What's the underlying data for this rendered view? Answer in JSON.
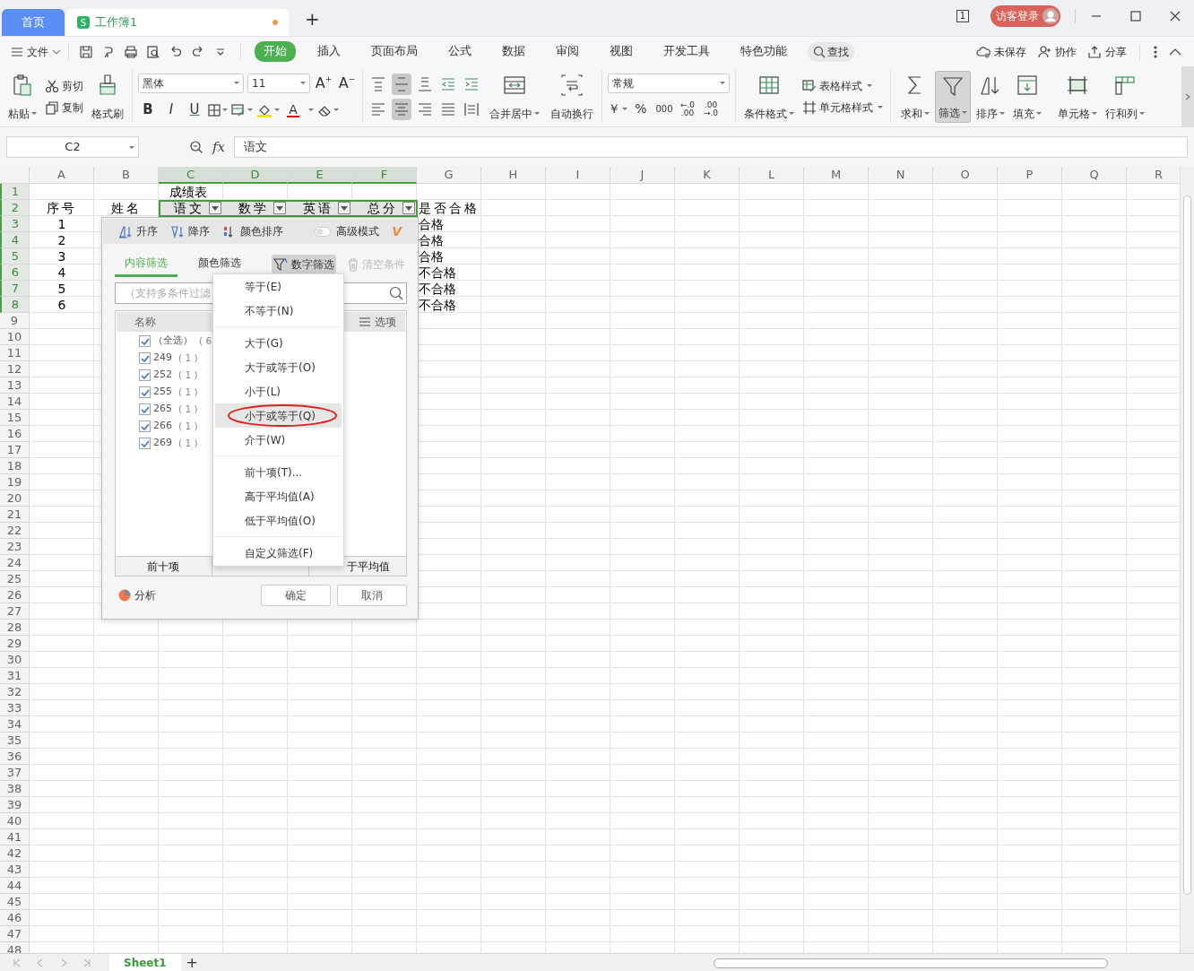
{
  "window_tabs": [
    {
      "label": "首页",
      "kind": "home",
      "selected": false
    },
    {
      "label": "工作簿1",
      "kind": "workbook",
      "badge": "S",
      "unsaved": true,
      "selected": true
    }
  ],
  "new_tab": "+",
  "title_bar": {
    "page_count": "1",
    "login": "访客登录"
  },
  "menu_bar": {
    "file": "文件",
    "tabs": [
      {
        "label": "开始",
        "selected": true
      },
      {
        "label": "插入",
        "selected": false
      },
      {
        "label": "页面布局",
        "selected": false
      },
      {
        "label": "公式",
        "selected": false
      },
      {
        "label": "数据",
        "selected": false
      },
      {
        "label": "审阅",
        "selected": false
      },
      {
        "label": "视图",
        "selected": false
      },
      {
        "label": "开发工具",
        "selected": false
      },
      {
        "label": "特色功能",
        "selected": false
      }
    ],
    "search": "查找",
    "actions": [
      {
        "label": "未保存",
        "kind": "cloud"
      },
      {
        "label": "协作",
        "kind": "collab"
      },
      {
        "label": "分享",
        "kind": "share"
      }
    ]
  },
  "ribbon": {
    "paste": "粘贴",
    "cut": "剪切",
    "copy": "复制",
    "format_painter": "格式刷",
    "font": "黑体",
    "font_size": "11",
    "size_buttons": [
      {
        "label": "A",
        "sign": "+"
      },
      {
        "label": "A",
        "sign": "−"
      }
    ],
    "style_buttons": [
      {
        "kind": "bold",
        "label": "B"
      },
      {
        "kind": "italic",
        "label": "I"
      },
      {
        "kind": "underline",
        "label": "U"
      }
    ],
    "font_color_label": "A",
    "alignment": [
      {
        "kind": "top",
        "selected": false
      },
      {
        "kind": "middle",
        "selected": true
      },
      {
        "kind": "bottom",
        "selected": false
      },
      {
        "kind": "outdent",
        "selected": false
      },
      {
        "kind": "indent",
        "selected": false
      },
      {
        "kind": "left",
        "selected": false
      },
      {
        "kind": "center",
        "selected": true
      },
      {
        "kind": "right",
        "selected": false
      },
      {
        "kind": "justify",
        "selected": false
      },
      {
        "kind": "distribute",
        "selected": false
      }
    ],
    "merge": "合并居中",
    "wrap": "自动换行",
    "number_format": "常规",
    "number_buttons": [
      {
        "kind": "currency",
        "label": "￥"
      },
      {
        "kind": "percent",
        "label": "%"
      },
      {
        "kind": "thousands",
        "label": "000"
      },
      {
        "kind": "inc_decimal",
        "top": "←.0",
        "bottom": ".00"
      },
      {
        "kind": "dec_decimal",
        "top": ".00",
        "bottom": "→.0"
      }
    ],
    "conditional_format": "条件格式",
    "table_style": "表格样式",
    "cell_style": "单元格样式",
    "tools": [
      {
        "label": "求和",
        "kind": "sum",
        "selected": false
      },
      {
        "label": "筛选",
        "kind": "filter",
        "selected": true
      },
      {
        "label": "排序",
        "kind": "sort",
        "selected": false
      },
      {
        "label": "填充",
        "kind": "fill",
        "selected": false
      },
      {
        "label": "单元格",
        "kind": "cell",
        "selected": false
      },
      {
        "label": "行和列",
        "kind": "rowcol",
        "selected": false
      }
    ]
  },
  "formula_bar": {
    "cell_ref": "C2",
    "function_label": "fx",
    "value": "语文"
  },
  "sheet": {
    "columns": [
      {
        "label": "A",
        "selected": false
      },
      {
        "label": "B",
        "selected": false
      },
      {
        "label": "C",
        "selected": true
      },
      {
        "label": "D",
        "selected": true
      },
      {
        "label": "E",
        "selected": true
      },
      {
        "label": "F",
        "selected": true
      },
      {
        "label": "G",
        "selected": false
      },
      {
        "label": "H",
        "selected": false
      },
      {
        "label": "I",
        "selected": false
      },
      {
        "label": "J",
        "selected": false
      },
      {
        "label": "K",
        "selected": false
      },
      {
        "label": "L",
        "selected": false
      },
      {
        "label": "M",
        "selected": false
      },
      {
        "label": "N",
        "selected": false
      },
      {
        "label": "O",
        "selected": false
      },
      {
        "label": "P",
        "selected": false
      },
      {
        "label": "Q",
        "selected": false
      },
      {
        "label": "R",
        "selected": false
      }
    ],
    "rows": [
      {
        "number": "1",
        "selected": true,
        "cells": {
          "C": {
            "text": "成绩表"
          }
        }
      },
      {
        "number": "2",
        "selected": true,
        "cells": {
          "A": {
            "text": "序号"
          },
          "B": {
            "text": "姓名"
          },
          "C": {
            "text": "语文",
            "filter": true
          },
          "D": {
            "text": "数学",
            "filter": true
          },
          "E": {
            "text": "英语",
            "filter": true
          },
          "F": {
            "text": "总分",
            "filter": true
          },
          "G": {
            "text": "是否合格"
          }
        }
      },
      {
        "number": "3",
        "selected": true,
        "cells": {
          "A": {
            "text": "1"
          },
          "G": {
            "text": "合格"
          }
        }
      },
      {
        "number": "4",
        "selected": true,
        "cells": {
          "A": {
            "text": "2"
          },
          "G": {
            "text": "合格"
          }
        }
      },
      {
        "number": "5",
        "selected": true,
        "cells": {
          "A": {
            "text": "3"
          },
          "G": {
            "text": "合格"
          }
        }
      },
      {
        "number": "6",
        "selected": true,
        "cells": {
          "A": {
            "text": "4"
          },
          "G": {
            "text": "不合格"
          }
        }
      },
      {
        "number": "7",
        "selected": true,
        "cells": {
          "A": {
            "text": "5"
          },
          "G": {
            "text": "不合格"
          }
        }
      },
      {
        "number": "8",
        "selected": true,
        "cells": {
          "A": {
            "text": "6"
          },
          "G": {
            "text": "不合格"
          }
        }
      },
      {
        "number": "9",
        "selected": false
      },
      {
        "number": "10",
        "selected": false
      },
      {
        "number": "11",
        "selected": false
      },
      {
        "number": "12",
        "selected": false
      },
      {
        "number": "13",
        "selected": false
      },
      {
        "number": "14",
        "selected": false
      },
      {
        "number": "15",
        "selected": false
      },
      {
        "number": "16",
        "selected": false
      },
      {
        "number": "17",
        "selected": false
      },
      {
        "number": "18",
        "selected": false
      },
      {
        "number": "19",
        "selected": false
      },
      {
        "number": "20",
        "selected": false
      },
      {
        "number": "21",
        "selected": false
      },
      {
        "number": "22",
        "selected": false
      },
      {
        "number": "23",
        "selected": false
      },
      {
        "number": "24",
        "selected": false
      },
      {
        "number": "25",
        "selected": false
      },
      {
        "number": "26",
        "selected": false
      },
      {
        "number": "27",
        "selected": false
      },
      {
        "number": "28",
        "selected": false
      },
      {
        "number": "29",
        "selected": false
      },
      {
        "number": "30",
        "selected": false
      },
      {
        "number": "31",
        "selected": false
      },
      {
        "number": "32",
        "selected": false
      },
      {
        "number": "33",
        "selected": false
      },
      {
        "number": "34",
        "selected": false
      },
      {
        "number": "35",
        "selected": false
      },
      {
        "number": "36",
        "selected": false
      },
      {
        "number": "37",
        "selected": false
      },
      {
        "number": "38",
        "selected": false
      },
      {
        "number": "39",
        "selected": false
      },
      {
        "number": "40",
        "selected": false
      },
      {
        "number": "41",
        "selected": false
      },
      {
        "number": "42",
        "selected": false
      },
      {
        "number": "43",
        "selected": false
      },
      {
        "number": "44",
        "selected": false
      },
      {
        "number": "45",
        "selected": false
      },
      {
        "number": "46",
        "selected": false
      },
      {
        "number": "47",
        "selected": false
      },
      {
        "number": "48",
        "selected": false
      }
    ]
  },
  "filter_panel": {
    "sort": [
      {
        "label": "升序",
        "kind": "asc"
      },
      {
        "label": "降序",
        "kind": "desc"
      },
      {
        "label": "颜色排序",
        "kind": "color"
      }
    ],
    "advanced_mode": {
      "label": "高级模式",
      "on": false,
      "badge": "V"
    },
    "tabs": [
      {
        "label": "内容筛选",
        "selected": true
      },
      {
        "label": "颜色筛选",
        "selected": false
      }
    ],
    "number_filter": {
      "label": "数字筛选",
      "selected": true
    },
    "clear": {
      "label": "清空条件",
      "disabled": true
    },
    "search": {
      "placeholder": "（支持多条件过滤"
    },
    "list_header": "名称",
    "options": "选项",
    "items": [
      {
        "label": "（全选）",
        "count": "( 6",
        "checked": true
      },
      {
        "label": "249",
        "count": "( 1 )",
        "checked": true
      },
      {
        "label": "252",
        "count": "( 1 )",
        "checked": true
      },
      {
        "label": "255",
        "count": "( 1 )",
        "checked": true
      },
      {
        "label": "265",
        "count": "( 1 )",
        "checked": true
      },
      {
        "label": "266",
        "count": "( 1 )",
        "checked": true
      },
      {
        "label": "269",
        "count": "( 1 )",
        "checked": true
      }
    ],
    "quick_buttons": [
      "前十项",
      "于平均值"
    ],
    "analysis": "分析",
    "ok": "确定",
    "cancel": "取消"
  },
  "number_filter_menu": {
    "groups": [
      {
        "items": [
          {
            "label": "等于(E)",
            "selected": false,
            "circled": false
          },
          {
            "label": "不等于(N)",
            "selected": false,
            "circled": false
          }
        ]
      },
      {
        "items": [
          {
            "label": "大于(G)",
            "selected": false,
            "circled": false
          },
          {
            "label": "大于或等于(O)",
            "selected": false,
            "circled": false
          },
          {
            "label": "小于(L)",
            "selected": false,
            "circled": false
          },
          {
            "label": "小于或等于(Q)",
            "selected": true,
            "circled": true
          },
          {
            "label": "介于(W)",
            "selected": false,
            "circled": false
          }
        ]
      },
      {
        "items": [
          {
            "label": "前十项(T)...",
            "selected": false,
            "circled": false
          },
          {
            "label": "高于平均值(A)",
            "selected": false,
            "circled": false
          },
          {
            "label": "低于平均值(O)",
            "selected": false,
            "circled": false
          }
        ]
      },
      {
        "items": [
          {
            "label": "自定义筛选(F)",
            "selected": false,
            "circled": false
          }
        ]
      }
    ]
  },
  "sheet_tabs": [
    {
      "label": "Sheet1",
      "selected": true
    }
  ],
  "add_sheet": "+"
}
